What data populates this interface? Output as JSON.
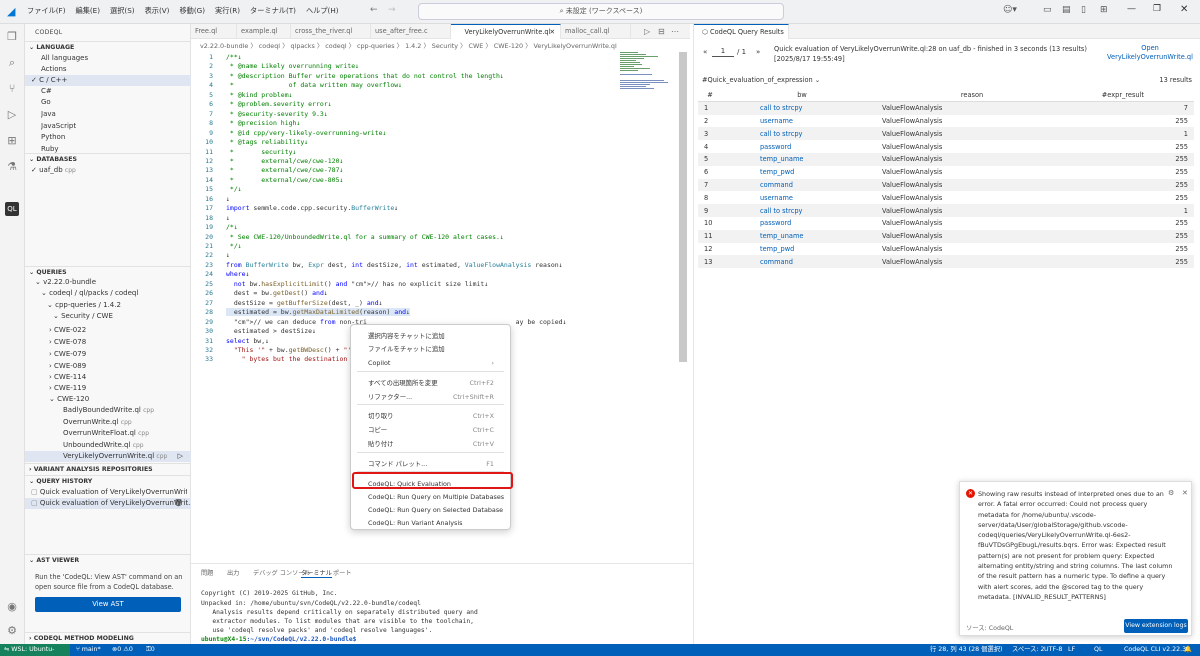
{
  "titlebar": {
    "menu": [
      "ファイル(F)",
      "編集(E)",
      "選択(S)",
      "表示(V)",
      "移動(G)",
      "実行(R)",
      "ターミナル(T)",
      "ヘルプ(H)"
    ],
    "command_center": "未設定 (ワークスペース)"
  },
  "sidebar": {
    "title": "CODEQL",
    "language_section": "LANGUAGE",
    "languages": [
      "All languages",
      "Actions",
      "C / C++",
      "C#",
      "Go",
      "Java",
      "JavaScript",
      "Python",
      "Ruby"
    ],
    "databases_section": "DATABASES",
    "database": {
      "name": "uaf_db",
      "lang": "cpp"
    },
    "queries_section": "QUERIES",
    "tree": [
      "v2.22.0-bundle",
      "codeql / ql/packs / codeql",
      "cpp-queries / 1.4.2",
      "Security / CWE",
      "CWE-022",
      "CWE-078",
      "CWE-079",
      "CWE-089",
      "CWE-114",
      "CWE-119",
      "CWE-120",
      "BadlyBoundedWrite.ql",
      "OverrunWrite.ql",
      "OverrunWriteFloat.ql",
      "UnboundedWrite.ql",
      "VeryLikelyOverrunWrite.ql"
    ],
    "lang_suffix": "cpp",
    "variant_section": "VARIANT ANALYSIS REPOSITORIES",
    "history_section": "QUERY HISTORY",
    "history": [
      "Quick evaluation of VeryLikelyOverrunWrite.ql...",
      "Quick evaluation of VeryLikelyOverrunWrit..."
    ],
    "ast_section": "AST VIEWER",
    "ast_text": "Run the 'CodeQL: View AST' command on an open source file from a CodeQL database.",
    "ast_button": "View AST",
    "method_section": "CODEQL METHOD MODELING"
  },
  "tabs": [
    "Free.ql",
    "example.ql",
    "cross_the_river.ql",
    "use_after_free.c",
    "VeryLikelyOverrunWrite.ql",
    "malloc_call.ql"
  ],
  "breadcrumb": "v2.22.0-bundle 〉 codeql 〉 qlpacks 〉 codeql 〉 cpp-queries 〉 1.4.2 〉 Security 〉 CWE 〉 CWE-120 〉  VeryLikelyOverrunWrite.ql",
  "editor": {
    "lines": [
      "/**↓",
      " * @name Likely overrunning write↓",
      " * @description Buffer write operations that do not control the length↓",
      " *              of data written may overflow↓",
      " * @kind problem↓",
      " * @problem.severity error↓",
      " * @security-severity 9.3↓",
      " * @precision high↓",
      " * @id cpp/very-likely-overrunning-write↓",
      " * @tags reliability↓",
      " *       security↓",
      " *       external/cwe/cwe-120↓",
      " *       external/cwe/cwe-787↓",
      " *       external/cwe/cwe-805↓",
      " */↓",
      "↓",
      "import semmle.code.cpp.security.BufferWrite↓",
      "↓",
      "/*↓",
      " * See CWE-120/UnboundedWrite.ql for a summary of CWE-120 alert cases.↓",
      " */↓",
      "↓",
      "from BufferWrite bw, Expr dest, int destSize, int estimated, ValueFlowAnalysis reason↓",
      "where↓",
      "  not bw.hasExplicitLimit() and // has no explicit size limit↓",
      "  dest = bw.getDest() and↓",
      "  destSize = getBufferSize(dest, _) and↓",
      "  estimated = bw.getMaxDataLimited(reason) and↓",
      "  // we can deduce from non-tri                                      ay be copied↓",
      "  estimated > destSize↓",
      "select bw,↓",
      "  \"This '\" + bw.getBWDesc() + \"'",
      "    \" bytes but the destination"
    ]
  },
  "context_menu": {
    "items": [
      {
        "label": "選択内容をチャットに追加",
        "key": ""
      },
      {
        "label": "ファイルをチャットに追加",
        "key": ""
      },
      {
        "label": "Copilot",
        "key": "›"
      },
      {
        "label": "すべての出現箇所を変更",
        "key": "Ctrl+F2"
      },
      {
        "label": "リファクター...",
        "key": "Ctrl+Shift+R"
      },
      {
        "label": "切り取り",
        "key": "Ctrl+X"
      },
      {
        "label": "コピー",
        "key": "Ctrl+C"
      },
      {
        "label": "貼り付け",
        "key": "Ctrl+V"
      },
      {
        "label": "コマンド パレット...",
        "key": "F1"
      },
      {
        "label": "CodeQL: Quick Evaluation",
        "key": ""
      },
      {
        "label": "CodeQL: Run Query on Multiple Databases",
        "key": ""
      },
      {
        "label": "CodeQL: Run Query on Selected Database",
        "key": ""
      },
      {
        "label": "CodeQL: Run Variant Analysis",
        "key": ""
      }
    ]
  },
  "panel": {
    "tabs": [
      "問題",
      "出力",
      "デバッグ コンソール",
      "ターミナル",
      "ポート"
    ],
    "terminal": [
      "Copyright (C) 2019-2025 GitHub, Inc.",
      "Unpacked in: /home/ubuntu/svn/CodeQL/v2.22.0-bundle/codeql",
      "   Analysis results depend critically on separately distributed query and",
      "   extractor modules. To list modules that are visible to the toolchain,",
      "   use 'codeql resolve packs' and 'codeql resolve languages'."
    ],
    "prompt_user": "ubuntu@X4-15",
    "prompt_path": ":~/svn/CodeQL/v2.22.0-bundle$"
  },
  "results": {
    "tab": "CodeQL Query Results",
    "page": "1",
    "page_total": "/ 1",
    "summary": "Quick evaluation of VeryLikelyOverrunWrite.ql:28 on uaf_db - finished in 3 seconds (13 results) [2025/8/17 19:55:49]",
    "open_link": "Open VeryLikelyOverrunWrite.ql",
    "result_set": "#Quick_evaluation_of_expression",
    "count": "13 results",
    "headers": [
      "#",
      "bw",
      "reason",
      "#expr_result"
    ],
    "rows": [
      [
        "1",
        "call to strcpy",
        "ValueFlowAnalysis",
        "7"
      ],
      [
        "2",
        "username",
        "ValueFlowAnalysis",
        "255"
      ],
      [
        "3",
        "call to strcpy",
        "ValueFlowAnalysis",
        "1"
      ],
      [
        "4",
        "password",
        "ValueFlowAnalysis",
        "255"
      ],
      [
        "5",
        "temp_uname",
        "ValueFlowAnalysis",
        "255"
      ],
      [
        "6",
        "temp_pwd",
        "ValueFlowAnalysis",
        "255"
      ],
      [
        "7",
        "command",
        "ValueFlowAnalysis",
        "255"
      ],
      [
        "8",
        "username",
        "ValueFlowAnalysis",
        "255"
      ],
      [
        "9",
        "call to strcpy",
        "ValueFlowAnalysis",
        "1"
      ],
      [
        "10",
        "password",
        "ValueFlowAnalysis",
        "255"
      ],
      [
        "11",
        "temp_uname",
        "ValueFlowAnalysis",
        "255"
      ],
      [
        "12",
        "temp_pwd",
        "ValueFlowAnalysis",
        "255"
      ],
      [
        "13",
        "command",
        "ValueFlowAnalysis",
        "255"
      ]
    ]
  },
  "toast": {
    "message": "Showing raw results instead of interpreted ones due to an error. A fatal error occurred: Could not process query metadata for /home/ubuntu/.vscode-server/data/User/globalStorage/github.vscode-codeql/queries/VeryLikelyOverrunWrite.ql-6es2-fBuVTDsGPgEbugL/results.bqrs. Error was: Expected result pattern(s) are not present for problem query: Expected alternating entity/string and string columns. The last column of the result pattern has a numeric type. To define a query with alert scores, add the @scored tag to the query metadata. [INVALID_RESULT_PATTERNS]",
    "source": "ソース: CodeQL",
    "button": "View extension logs"
  },
  "status": {
    "remote": "WSL: Ubuntu-24.04",
    "branch": "main*",
    "problems": "⊗0 ⚠0",
    "ports": "⚿0",
    "position": "行 28, 列 43 (28 個選択)",
    "spaces": "スペース: 2",
    "encoding": "UTF-8",
    "eol": "LF",
    "lang": "QL",
    "cli": "CodeQL CLI v2.22.3"
  }
}
